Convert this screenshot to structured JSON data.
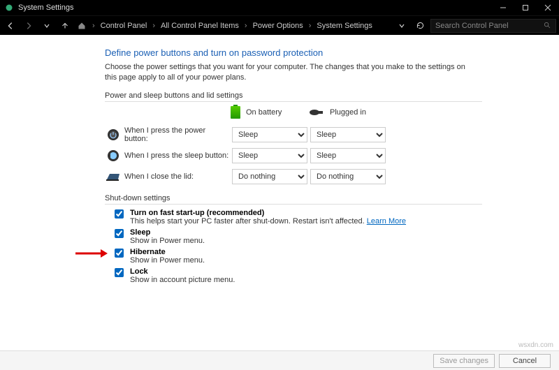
{
  "window": {
    "title": "System Settings"
  },
  "breadcrumb": {
    "items": [
      "Control Panel",
      "All Control Panel Items",
      "Power Options",
      "System Settings"
    ]
  },
  "search": {
    "placeholder": "Search Control Panel"
  },
  "page": {
    "heading": "Define power buttons and turn on password protection",
    "subtext": "Choose the power settings that you want for your computer. The changes that you make to the settings on this page apply to all of your power plans.",
    "section1_label": "Power and sleep buttons and lid settings",
    "col_battery": "On battery",
    "col_plugged": "Plugged in",
    "rows": [
      {
        "label": "When I press the power button:",
        "battery": "Sleep",
        "plugged": "Sleep"
      },
      {
        "label": "When I press the sleep button:",
        "battery": "Sleep",
        "plugged": "Sleep"
      },
      {
        "label": "When I close the lid:",
        "battery": "Do nothing",
        "plugged": "Do nothing"
      }
    ],
    "section2_label": "Shut-down settings",
    "sd": [
      {
        "title": "Turn on fast start-up (recommended)",
        "desc": "This helps start your PC faster after shut-down. Restart isn't affected. ",
        "link": "Learn More",
        "checked": true
      },
      {
        "title": "Sleep",
        "desc": "Show in Power menu.",
        "checked": true
      },
      {
        "title": "Hibernate",
        "desc": "Show in Power menu.",
        "checked": true,
        "arrow": true
      },
      {
        "title": "Lock",
        "desc": "Show in account picture menu.",
        "checked": true
      }
    ]
  },
  "footer": {
    "save": "Save changes",
    "cancel": "Cancel"
  },
  "watermark": "wsxdn.com"
}
